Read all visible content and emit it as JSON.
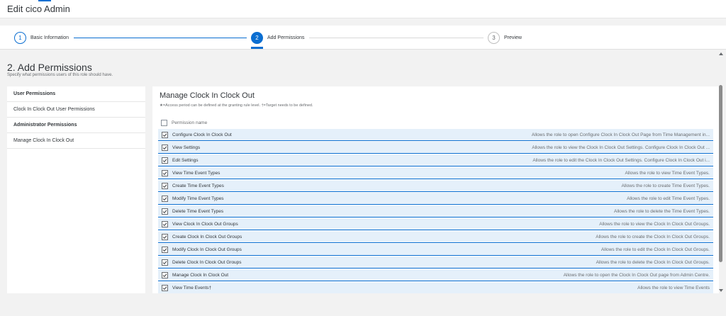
{
  "page": {
    "title": "Edit cico Admin"
  },
  "wizard": {
    "steps": [
      {
        "number": "1",
        "label": "Basic Information",
        "state": "done"
      },
      {
        "number": "2",
        "label": "Add Permissions",
        "state": "active"
      },
      {
        "number": "3",
        "label": "Preview",
        "state": "todo"
      }
    ]
  },
  "section": {
    "title": "2. Add Permissions",
    "subtitle": "Specify what permissions users of this role should have."
  },
  "sidebar": {
    "user_group": "User Permissions",
    "user_item": "Clock In Clock Out User Permissions",
    "admin_group": "Administrator Permissions",
    "admin_item": "Manage Clock In Clock Out"
  },
  "main": {
    "title": "Manage Clock In Clock Out",
    "note": "★=Access period can be defined at the granting rule level.   †=Target needs to be defined.",
    "header_label": "Permission name",
    "permissions": [
      {
        "name": "Configure Clock In Clock Out",
        "desc": "Allows the role to open Configure Clock In Clock Out Page from Time Management in...",
        "checked": true
      },
      {
        "name": "View Settings",
        "desc": "Allows the role to view the Clock In Clock Out Settings. Configure Clock In Clock Out ...",
        "checked": true
      },
      {
        "name": "Edit Settings",
        "desc": "Allows the role to edit the Clock In Clock Out Settings. Configure Clock In Clock Out i...",
        "checked": true
      },
      {
        "name": "View Time Event Types",
        "desc": "Allows the role to view Time Event Types.",
        "checked": true
      },
      {
        "name": "Create Time Event Types",
        "desc": "Allows the role to create Time Event Types.",
        "checked": true
      },
      {
        "name": "Modify Time Event Types",
        "desc": "Allows the role to edit Time Event Types.",
        "checked": true
      },
      {
        "name": "Delete Time Event Types",
        "desc": "Allows the role to delete the Time Event Types.",
        "checked": true
      },
      {
        "name": "View Clock In Clock Out Groups",
        "desc": "Allows the role to view the Clock In Clock Out Groups.",
        "checked": true
      },
      {
        "name": "Create Clock In Clock Out Groups",
        "desc": "Allows the role to create the Clock In Clock Out Groups.",
        "checked": true
      },
      {
        "name": "Modify Clock In Clock Out Groups",
        "desc": "Allows the role to edit the Clock In Clock Out Groups.",
        "checked": true
      },
      {
        "name": "Delete Clock In Clock Out Groups",
        "desc": "Allows the role to delete the Clock In Clock Out Groups.",
        "checked": true
      },
      {
        "name": "Manage Clock In Clock Out",
        "desc": "Allows the role to open the Clock In Clock Out page from Admin Centre.",
        "checked": true
      },
      {
        "name": "View Time Events†",
        "desc": "Allows the role to view Time Events",
        "checked": true
      }
    ]
  },
  "colors": {
    "accent": "#0a6ed1",
    "row_selected_bg": "#e5f0fa"
  }
}
